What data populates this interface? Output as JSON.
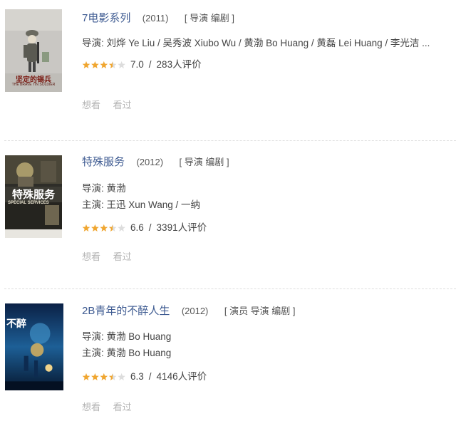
{
  "items": [
    {
      "title": "7电影系列",
      "year": "(2011)",
      "roles": "[ 导演 编剧 ]",
      "lines": [
        "导演: 刘烨 Ye Liu / 吴秀波 Xiubo Wu / 黄渤 Bo Huang / 黄磊 Lei Huang / 李光洁 ..."
      ],
      "stars": 3.5,
      "score": "7.0",
      "sep": "/",
      "votes": "283人评价",
      "want": "想看",
      "seen": "看过",
      "poster_caption": "坚定的锡兵",
      "poster_subcaption": "THE BRAVE TIN SOLDIER",
      "poster_colors": {
        "bg": "#c9c7c3",
        "figure": "#5a5a52"
      }
    },
    {
      "title": "特殊服务",
      "year": "(2012)",
      "roles": "[ 导演 编剧 ]",
      "lines": [
        "导演: 黄渤",
        "主演: 王迅 Xun Wang / 一纳"
      ],
      "stars": 3.5,
      "score": "6.6",
      "sep": "/",
      "votes": "3391人评价",
      "want": "想看",
      "seen": "看过",
      "poster_caption": "特殊服务",
      "poster_subcaption": "SPECIAL SERVICES",
      "poster_colors": {
        "bg": "#3b3a33",
        "figure": "#a89a6a"
      }
    },
    {
      "title": "2B青年的不醉人生",
      "year": "(2012)",
      "roles": "[ 演员 导演 编剧 ]",
      "lines": [
        "导演: 黄渤 Bo Huang",
        "主演: 黄渤 Bo Huang"
      ],
      "stars": 3.5,
      "score": "6.3",
      "sep": "/",
      "votes": "4146人评价",
      "want": "想看",
      "seen": "看过",
      "poster_caption": "不醉",
      "poster_subcaption": "",
      "poster_colors": {
        "bg": "#0a2a55",
        "figure": "#3f8fc4"
      }
    }
  ],
  "colors": {
    "link": "#3d5a91",
    "star_on": "#f0a630",
    "star_off": "#dddddd",
    "action": "#b5b5b5"
  }
}
